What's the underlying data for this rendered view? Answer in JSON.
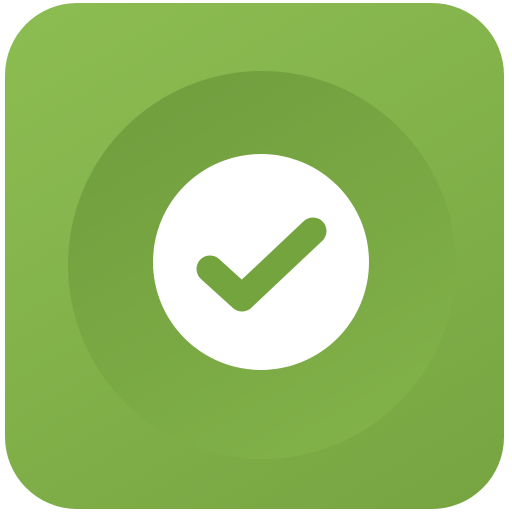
{
  "icon": {
    "name": "check-icon",
    "symbol": "check-mark"
  },
  "colors": {
    "tile_light": "#8cbd52",
    "tile_dark": "#76a441",
    "halo": "#74a240",
    "badge": "#ffffff",
    "check": "#74a43e"
  }
}
